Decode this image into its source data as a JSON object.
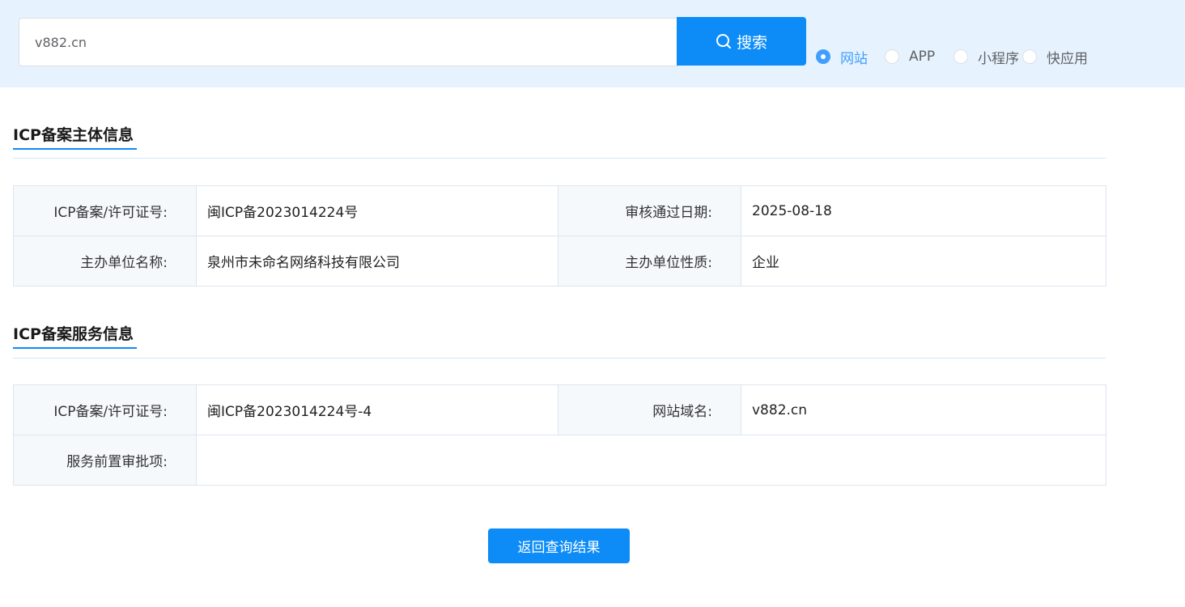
{
  "search": {
    "value": "v882.cn",
    "button_label": "搜索",
    "icon": "search-icon"
  },
  "type_options": [
    {
      "label": "网站",
      "checked": true
    },
    {
      "label": "APP",
      "checked": false
    },
    {
      "label": "小程序",
      "checked": false
    },
    {
      "label": "快应用",
      "checked": false
    }
  ],
  "subject_section": {
    "title": "ICP备案主体信息",
    "rows": [
      {
        "label1": "ICP备案/许可证号:",
        "value1": "闽ICP备2023014224号",
        "label2": "审核通过日期:",
        "value2": "2025-08-18"
      },
      {
        "label1": "主办单位名称:",
        "value1": "泉州市未命名网络科技有限公司",
        "label2": "主办单位性质:",
        "value2": "企业"
      }
    ]
  },
  "service_section": {
    "title": "ICP备案服务信息",
    "row1": {
      "label1": "ICP备案/许可证号:",
      "value1": "闽ICP备2023014224号-4",
      "label2": "网站域名:",
      "value2": "v882.cn"
    },
    "row2": {
      "label": "服务前置审批项:",
      "value": ""
    }
  },
  "back_button_label": "返回查询结果",
  "colors": {
    "accent": "#0d8cf8",
    "radio_checked": "#409eff",
    "topbar_bg": "#e6f2fd"
  }
}
